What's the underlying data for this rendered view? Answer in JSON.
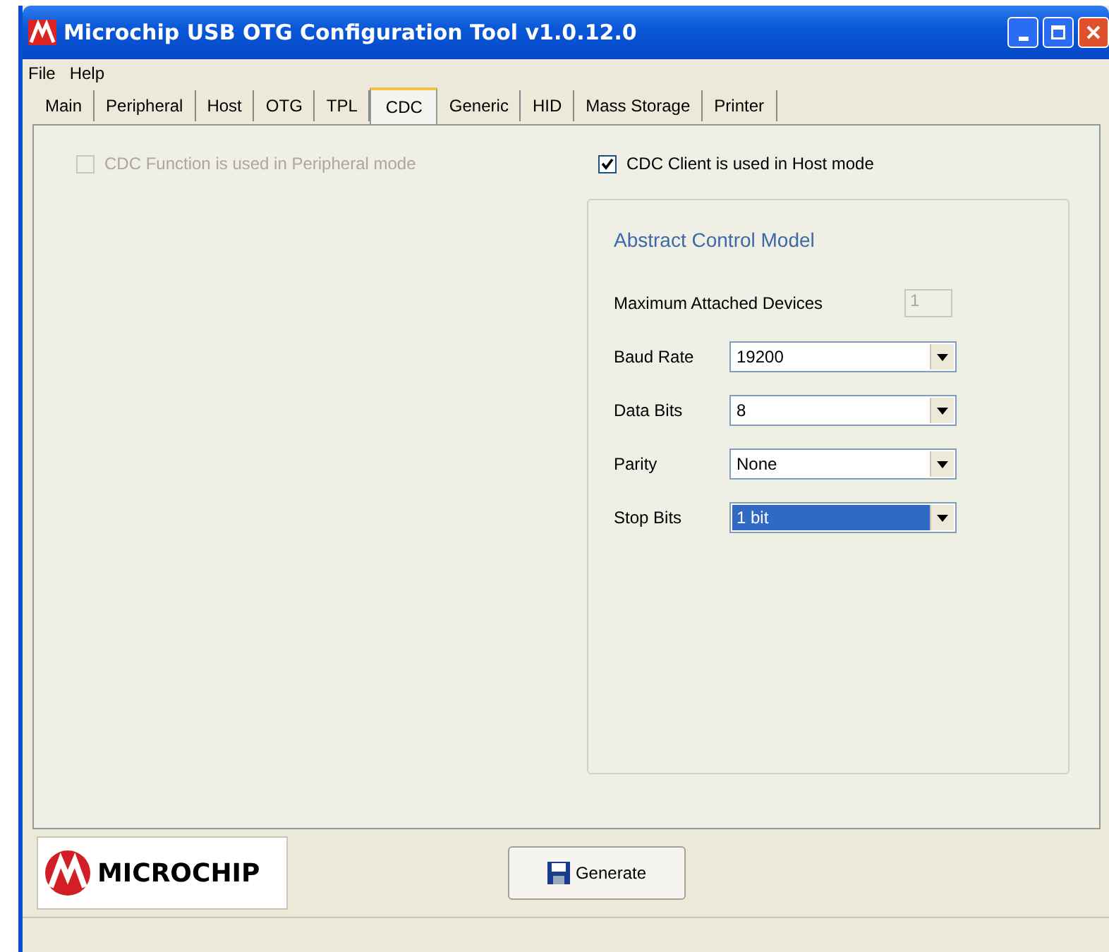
{
  "window": {
    "title": "Microchip USB OTG Configuration Tool v1.0.12.0"
  },
  "menu": [
    "File",
    "Help"
  ],
  "tabs": [
    {
      "label": "Main",
      "selected": false
    },
    {
      "label": "Peripheral",
      "selected": false
    },
    {
      "label": "Host",
      "selected": false
    },
    {
      "label": "OTG",
      "selected": false
    },
    {
      "label": "TPL",
      "selected": false
    },
    {
      "label": "CDC",
      "selected": true
    },
    {
      "label": "Generic",
      "selected": false
    },
    {
      "label": "HID",
      "selected": false
    },
    {
      "label": "Mass Storage",
      "selected": false
    },
    {
      "label": "Printer",
      "selected": false
    }
  ],
  "peripheral_option": {
    "label": "CDC Function is used in Peripheral mode",
    "checked": false,
    "disabled": true
  },
  "host_option": {
    "label": "CDC Client is used in Host mode",
    "checked": true,
    "disabled": false
  },
  "group": {
    "title": "Abstract Control Model",
    "fields": [
      {
        "kind": "textbox",
        "label": "Maximum Attached Devices",
        "value": "1",
        "disabled": true
      },
      {
        "kind": "dropdown",
        "label": "Baud Rate",
        "value": "19200",
        "selected": false
      },
      {
        "kind": "dropdown",
        "label": "Data Bits",
        "value": "8",
        "selected": false
      },
      {
        "kind": "dropdown",
        "label": "Parity",
        "value": "None",
        "selected": false
      },
      {
        "kind": "dropdown",
        "label": "Stop Bits",
        "value": "1 bit",
        "selected": true
      }
    ]
  },
  "logo": "MICROCHIP",
  "generate_button": "Generate"
}
